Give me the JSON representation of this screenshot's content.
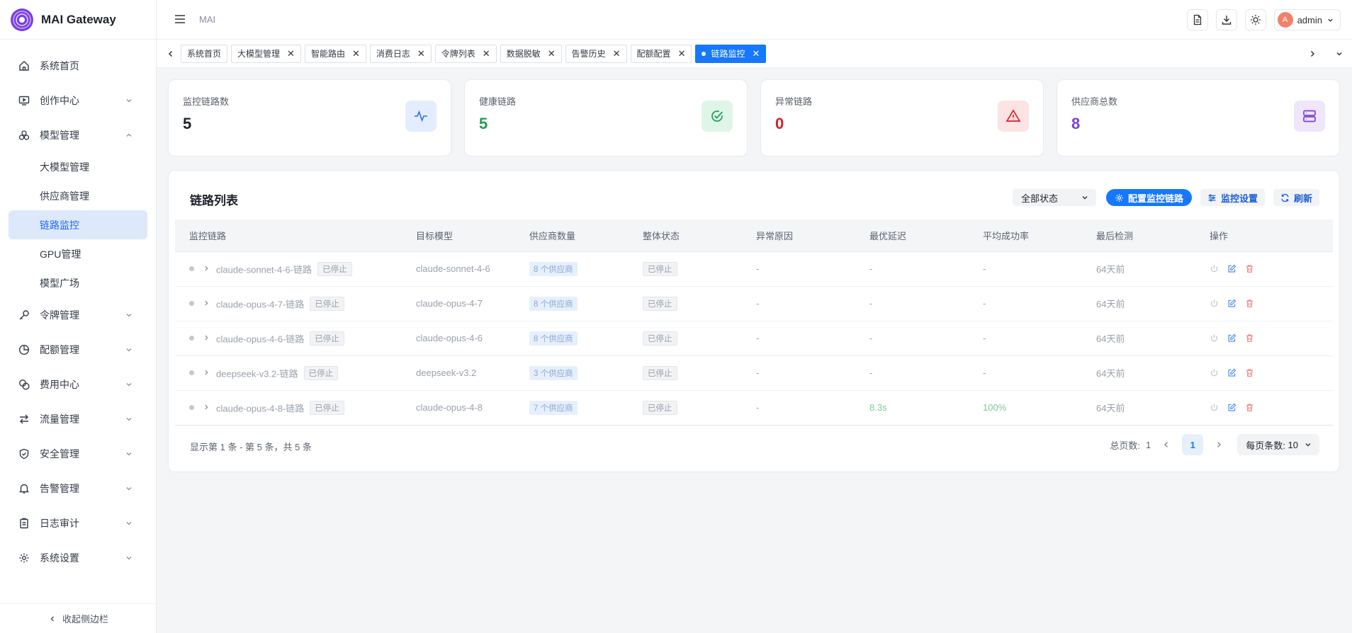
{
  "app": {
    "name": "MAI Gateway",
    "breadcrumb": "MAI"
  },
  "sidebar": {
    "items": [
      {
        "label": "系统首页"
      },
      {
        "label": "创作中心"
      },
      {
        "label": "模型管理"
      },
      {
        "label": "令牌管理"
      },
      {
        "label": "配额管理"
      },
      {
        "label": "费用中心"
      },
      {
        "label": "流量管理"
      },
      {
        "label": "安全管理"
      },
      {
        "label": "告警管理"
      },
      {
        "label": "日志审计"
      },
      {
        "label": "系统设置"
      }
    ],
    "sub_items": [
      {
        "label": "大模型管理"
      },
      {
        "label": "供应商管理"
      },
      {
        "label": "链路监控"
      },
      {
        "label": "GPU管理"
      },
      {
        "label": "模型广场"
      }
    ],
    "collapse_label": "收起侧边栏"
  },
  "header": {
    "user": "admin",
    "avatar_letter": "A"
  },
  "tabs": [
    {
      "label": "系统首页"
    },
    {
      "label": "大模型管理"
    },
    {
      "label": "智能路由"
    },
    {
      "label": "消费日志"
    },
    {
      "label": "令牌列表"
    },
    {
      "label": "数据脱敏"
    },
    {
      "label": "告警历史"
    },
    {
      "label": "配额配置"
    },
    {
      "label": "链路监控"
    }
  ],
  "stats": [
    {
      "label": "监控链路数",
      "value": "5",
      "color": "#1f2329"
    },
    {
      "label": "健康链路",
      "value": "5",
      "color": "#1f9d55"
    },
    {
      "label": "异常链路",
      "value": "0",
      "color": "#d6212a"
    },
    {
      "label": "供应商总数",
      "value": "8",
      "color": "#7b3fd6"
    }
  ],
  "panel": {
    "title": "链路列表",
    "status_filter": "全部状态",
    "config_button": "配置监控链路",
    "settings_button": "监控设置",
    "refresh_button": "刷新"
  },
  "table": {
    "columns": [
      "监控链路",
      "目标模型",
      "供应商数量",
      "整体状态",
      "异常原因",
      "最优延迟",
      "平均成功率",
      "最后检测",
      "操作"
    ],
    "rows": [
      {
        "name": "claude-sonnet-4-6-链路",
        "tag": "已停止",
        "model": "claude-sonnet-4-6",
        "providers": "8 个供应商",
        "status": "已停止",
        "reason": "-",
        "latency": "-",
        "success": "-",
        "last": "64天前"
      },
      {
        "name": "claude-opus-4-7-链路",
        "tag": "已停止",
        "model": "claude-opus-4-7",
        "providers": "8 个供应商",
        "status": "已停止",
        "reason": "-",
        "latency": "-",
        "success": "-",
        "last": "64天前"
      },
      {
        "name": "claude-opus-4-6-链路",
        "tag": "已停止",
        "model": "claude-opus-4-6",
        "providers": "8 个供应商",
        "status": "已停止",
        "reason": "-",
        "latency": "-",
        "success": "-",
        "last": "64天前"
      },
      {
        "name": "deepseek-v3.2-链路",
        "tag": "已停止",
        "model": "deepseek-v3.2",
        "providers": "3 个供应商",
        "status": "已停止",
        "reason": "-",
        "latency": "-",
        "success": "-",
        "last": "64天前"
      },
      {
        "name": "claude-opus-4-8-链路",
        "tag": "已停止",
        "model": "claude-opus-4-8",
        "providers": "7 个供应商",
        "status": "已停止",
        "reason": "-",
        "latency": "8.3s",
        "success": "100%",
        "last": "64天前"
      }
    ]
  },
  "footer": {
    "summary": "显示第 1 条 - 第 5 条，共 5 条",
    "total_pages_label": "总页数:",
    "total_pages": "1",
    "current_page": "1",
    "page_size_label": "每页条数:",
    "page_size": "10"
  },
  "colors": {
    "accent": "#1677ff"
  }
}
